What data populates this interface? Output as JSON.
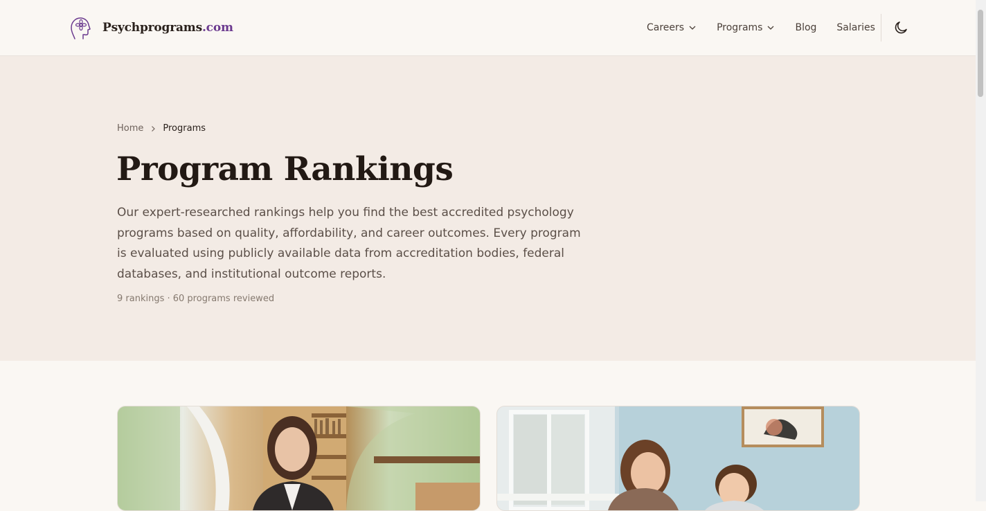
{
  "brand": {
    "name": "Psychprograms",
    "tld": ".com"
  },
  "nav": {
    "careers": "Careers",
    "programs": "Programs",
    "blog": "Blog",
    "salaries": "Salaries"
  },
  "breadcrumb": {
    "home": "Home",
    "current": "Programs"
  },
  "hero": {
    "title": "Program Rankings",
    "description": "Our expert-researched rankings help you find the best accredited psychology programs based on quality, affordability, and career outcomes. Every program is evaluated using publicly available data from accreditation bodies, federal databases, and institutional outcome reports.",
    "meta": "9 rankings · 60 programs reviewed"
  },
  "icons": {
    "logo": "head-flower-icon",
    "dropdown": "chevron-down-icon",
    "separator": "chevron-right-icon",
    "theme": "moon-icon"
  },
  "colors": {
    "accent": "#6b3a8f",
    "hero_bg": "#f3ebe5",
    "page_bg": "#faf7f3"
  }
}
